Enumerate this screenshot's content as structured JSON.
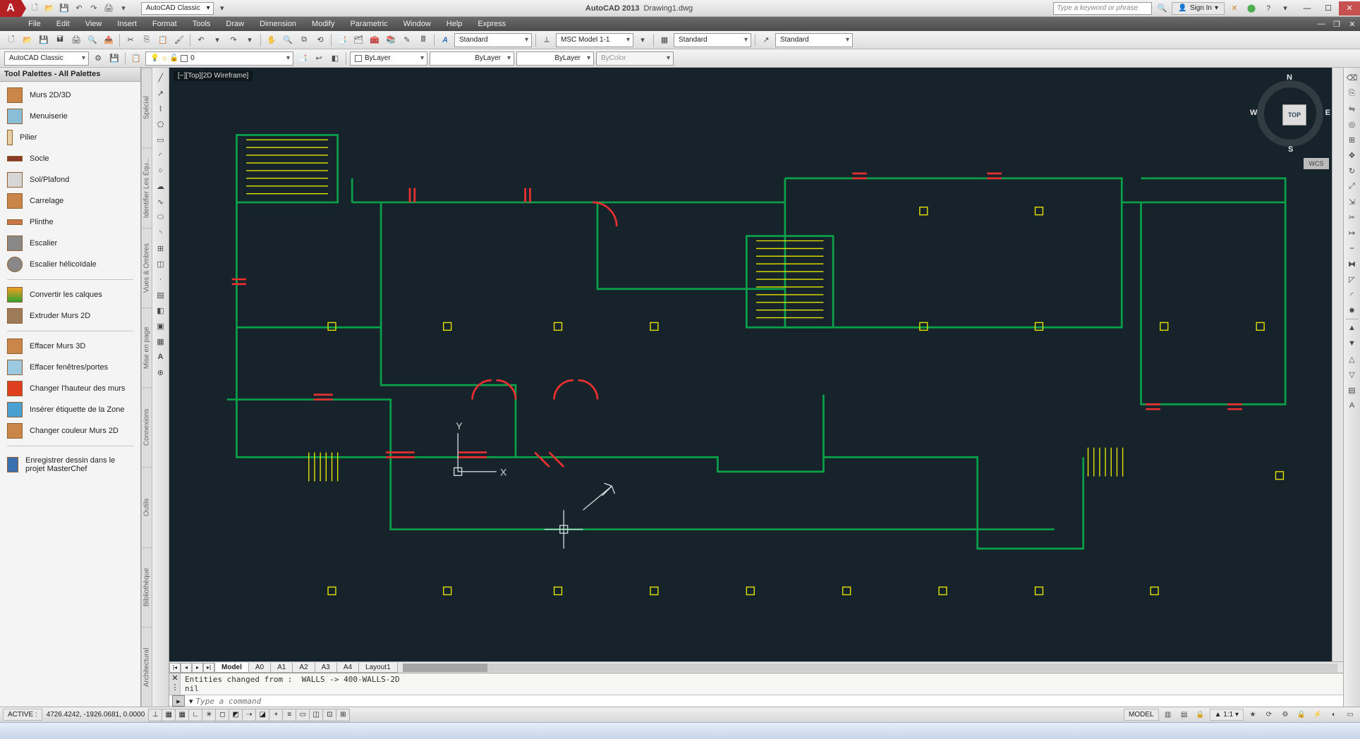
{
  "titlebar": {
    "workspace_selector": "AutoCAD Classic",
    "app_name": "AutoCAD 2013",
    "document": "Drawing1.dwg",
    "search_placeholder": "Type a keyword or phrase",
    "signin": "Sign In"
  },
  "menus": [
    "File",
    "Edit",
    "View",
    "Insert",
    "Format",
    "Tools",
    "Draw",
    "Dimension",
    "Modify",
    "Parametric",
    "Window",
    "Help",
    "Express"
  ],
  "toolbar1": {
    "text_style": "Standard",
    "dim_style": "MSC Model 1-1",
    "table_style": "Standard",
    "ml_style": "Standard"
  },
  "toolbar2": {
    "workspace": "AutoCAD Classic",
    "layer": "0",
    "layer_prefix": "",
    "color": "ByLayer",
    "linetype": "ByLayer",
    "lineweight": "ByLayer",
    "plotstyle": "ByColor"
  },
  "palette": {
    "title": "Tool Palettes - All Palettes",
    "groups": [
      [
        "Murs 2D/3D",
        "Menuiserie",
        "Pilier",
        "Socle",
        "Sol/Plafond",
        "Carrelage",
        "Plinthe",
        "Escalier",
        "Escalier hélicoïdale"
      ],
      [
        "Convertir les calques",
        "Extruder Murs 2D"
      ],
      [
        "Effacer Murs 3D",
        "Effacer fenêtres/portes",
        "Changer l'hauteur des murs",
        "Insérer étiquette de la Zone",
        "Changer couleur Murs 2D"
      ],
      [
        "Enregistrer dessin dans le projet MasterChef"
      ]
    ],
    "tabs": [
      "Spécial",
      "Identifier Les Équ...",
      "Vues & Ombres",
      "Mise en page",
      "Connexions",
      "Outils",
      "Bibliothèque",
      "Architectural"
    ]
  },
  "viewport": {
    "label": "[−][Top][2D Wireframe]",
    "cube_face": "TOP",
    "wcs": "WCS",
    "compass": {
      "n": "N",
      "e": "E",
      "s": "S",
      "w": "W"
    }
  },
  "ucs_axes": {
    "x": "X",
    "y": "Y"
  },
  "layout_tabs": [
    "Model",
    "A0",
    "A1",
    "A2",
    "A3",
    "A4",
    "Layout1"
  ],
  "active_layout": "Model",
  "command": {
    "history": "Entities changed from :  WALLS -> 400-WALLS-2D\nnil",
    "placeholder": "Type a command"
  },
  "status": {
    "left": "ACTIVE :",
    "coords": "4726.4242, -1926.0681, 0.0000",
    "model": "MODEL",
    "scale": "1:1"
  }
}
